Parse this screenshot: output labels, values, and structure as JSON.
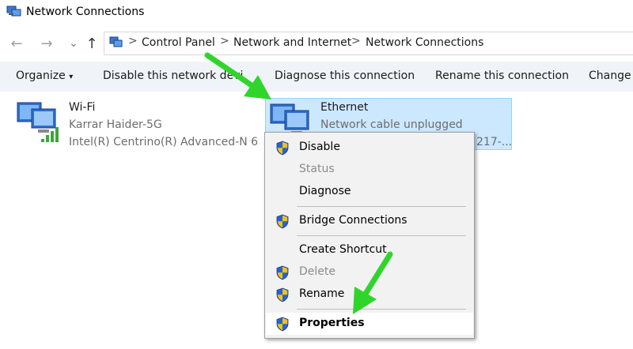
{
  "window": {
    "title": "Network Connections"
  },
  "nav": {
    "back": "←",
    "forward": "→",
    "recent": "⌄",
    "up": "↑"
  },
  "breadcrumb": {
    "items": [
      "Control Panel",
      "Network and Internet",
      "Network Connections"
    ],
    "separator": ">"
  },
  "toolbar": {
    "organize": "Organize",
    "organize_caret": "▾",
    "disable": "Disable this network device",
    "diagnose": "Diagnose this connection",
    "rename": "Rename this connection",
    "change": "Change settings of this connection"
  },
  "connections": [
    {
      "name": "Wi-Fi",
      "line1": "Karrar Haider-5G",
      "line2": "Intel(R) Centrino(R) Advanced-N 6..."
    },
    {
      "name": "Ethernet",
      "line1": "Network cable unplugged",
      "line2": "217-..."
    }
  ],
  "context_menu": {
    "items": [
      {
        "label": "Disable",
        "shield": true,
        "enabled": true
      },
      {
        "label": "Status",
        "shield": false,
        "enabled": false
      },
      {
        "label": "Diagnose",
        "shield": false,
        "enabled": true
      },
      {
        "label": "Bridge Connections",
        "shield": true,
        "enabled": true
      },
      {
        "label": "Create Shortcut",
        "shield": false,
        "enabled": true
      },
      {
        "label": "Delete",
        "shield": true,
        "enabled": false
      },
      {
        "label": "Rename",
        "shield": true,
        "enabled": true
      },
      {
        "label": "Properties",
        "shield": true,
        "enabled": true,
        "default": true
      }
    ]
  },
  "colors": {
    "selection": "#cce8ff",
    "toolbar_bg": "#f0f4f9",
    "arrow": "#2fd52b",
    "shield_blue": "#2a62c9",
    "shield_yellow": "#f2c21b"
  }
}
